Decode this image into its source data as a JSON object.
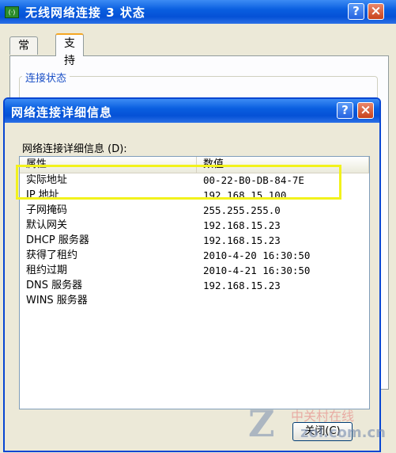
{
  "back_window": {
    "title": "无线网络连接 3 状态",
    "title_icon": "(·)",
    "tabs": [
      "常规",
      "支持"
    ],
    "active_tab": 1,
    "groupbox_label": "连接状态"
  },
  "dialog": {
    "title": "网络连接详细信息",
    "list_label": "网络连接详细信息 (D):",
    "columns": [
      "属性",
      "数值"
    ],
    "rows": [
      {
        "prop": "实际地址",
        "value": "00-22-B0-DB-84-7E"
      },
      {
        "prop": "IP 地址",
        "value": "192.168.15.100"
      },
      {
        "prop": "子网掩码",
        "value": "255.255.255.0"
      },
      {
        "prop": "默认网关",
        "value": "192.168.15.23"
      },
      {
        "prop": "DHCP 服务器",
        "value": "192.168.15.23"
      },
      {
        "prop": "获得了租约",
        "value": "2010-4-20 16:30:50"
      },
      {
        "prop": "租约过期",
        "value": "2010-4-21 16:30:50"
      },
      {
        "prop": "DNS 服务器",
        "value": "192.168.15.23"
      },
      {
        "prop": "WINS 服务器",
        "value": ""
      }
    ],
    "close_button": "关闭(C)"
  },
  "titlebar_buttons": {
    "help": "?",
    "close": "×"
  },
  "watermark": {
    "cn": "中关村在线",
    "url": "zol.com.cn"
  },
  "colors": {
    "titlebar": "#0551D6",
    "highlight": "#F2F21C",
    "active_tab_accent": "#F5A623"
  }
}
